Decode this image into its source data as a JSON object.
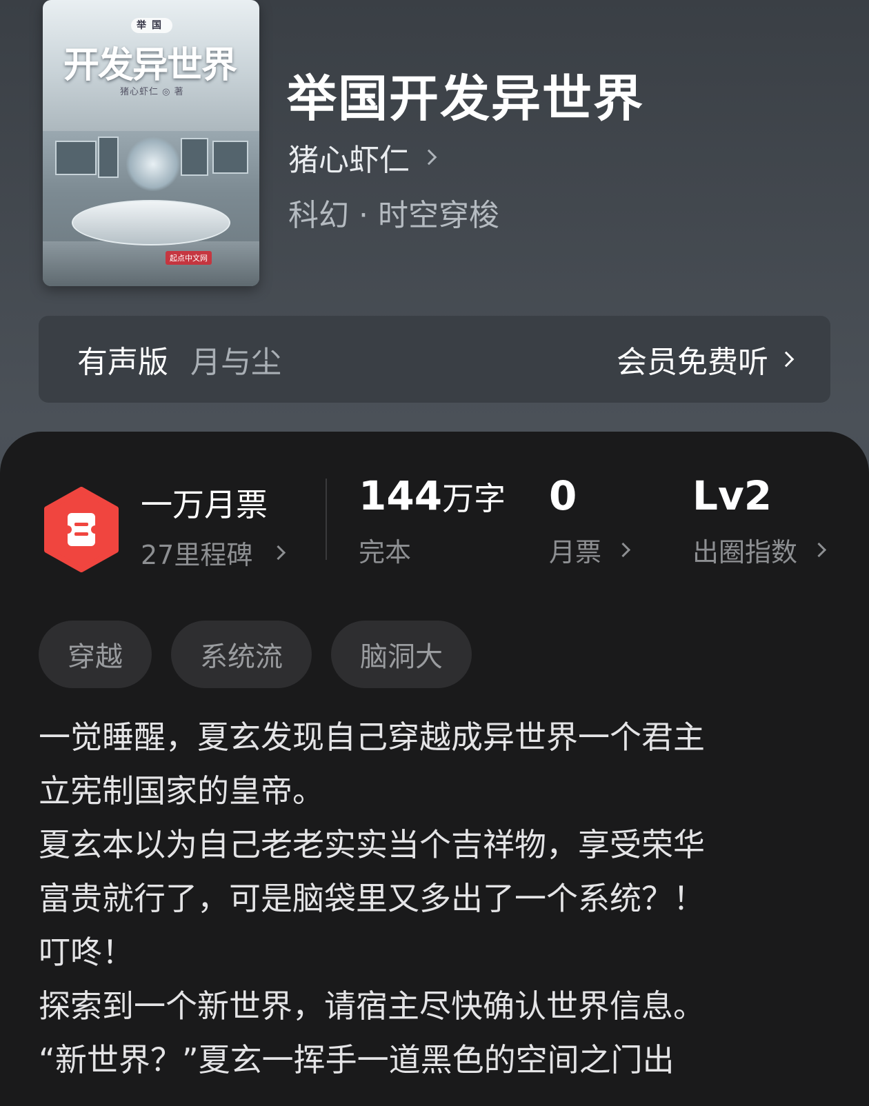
{
  "book": {
    "cover": {
      "tag": "举国",
      "title": "开发异世界",
      "author": "猪心虾仁 ◎ 著",
      "publisher": "起点中文网"
    },
    "title": "举国开发异世界",
    "author": "猪心虾仁",
    "genre": "科幻 · 时空穿梭"
  },
  "audio": {
    "label": "有声版",
    "reader": "月与尘",
    "cta": "会员免费听"
  },
  "stats": {
    "ticket": {
      "title": "一万月票",
      "sub": "27里程碑"
    },
    "words": {
      "value": "144",
      "unit": "万字",
      "label": "完本"
    },
    "votes": {
      "value": "0",
      "label": "月票"
    },
    "index": {
      "value": "Lv2",
      "label": "出圈指数"
    }
  },
  "tags": [
    "穿越",
    "系统流",
    "脑洞大"
  ],
  "synopsis": [
    "一觉睡醒，夏玄发现自己穿越成异世界一个君主\n立宪制国家的皇帝。",
    "夏玄本以为自己老老实实当个吉祥物，享受荣华\n富贵就行了，可是脑袋里又多出了一个系统？！",
    "叮咚！",
    "探索到一个新世界，请宿主尽快确认世界信息。",
    "“新世界？”夏玄一挥手一道黑色的空间之门出"
  ],
  "colors": {
    "panel": "#1a1a1b",
    "tag_bg": "#2e2e30",
    "ticket_red": "#f0453f",
    "muted": "#8d8f92"
  }
}
